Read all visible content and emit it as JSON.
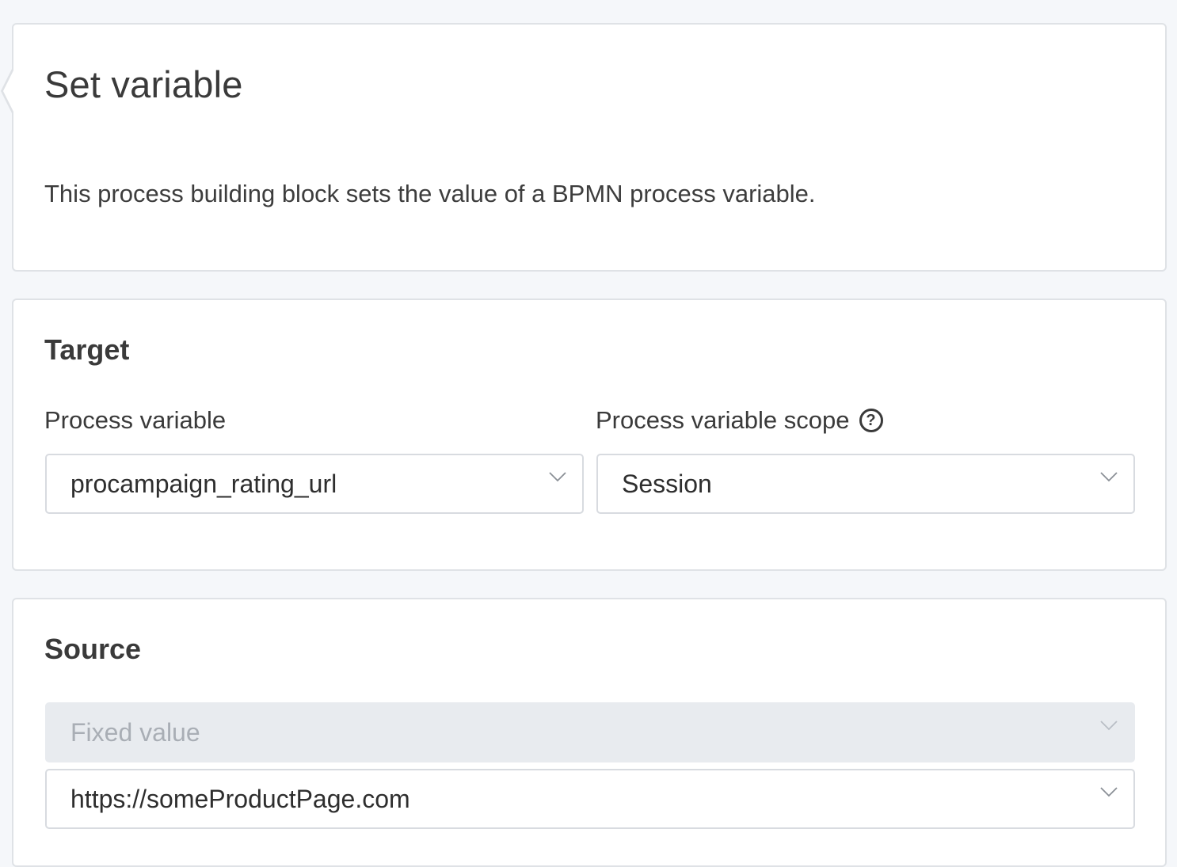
{
  "header": {
    "title": "Set variable",
    "description": "This process building block sets the value of a BPMN process variable."
  },
  "target": {
    "section_title": "Target",
    "process_variable": {
      "label": "Process variable",
      "value": "procampaign_rating_url"
    },
    "scope": {
      "label": "Process variable scope",
      "help_icon_glyph": "?",
      "value": "Session"
    }
  },
  "source": {
    "section_title": "Source",
    "source_type": {
      "value": "Fixed value",
      "disabled": true
    },
    "fixed_value": {
      "value": "https://someProductPage.com"
    }
  },
  "icons": {
    "dropdown": "chevron-down-icon",
    "help": "help-circle-icon"
  },
  "colors": {
    "background": "#f5f7fa",
    "card_border": "#dfe2e6",
    "text": "#3a3a3a",
    "disabled_bg": "#e8ebef",
    "disabled_text": "#a9aeb5"
  }
}
